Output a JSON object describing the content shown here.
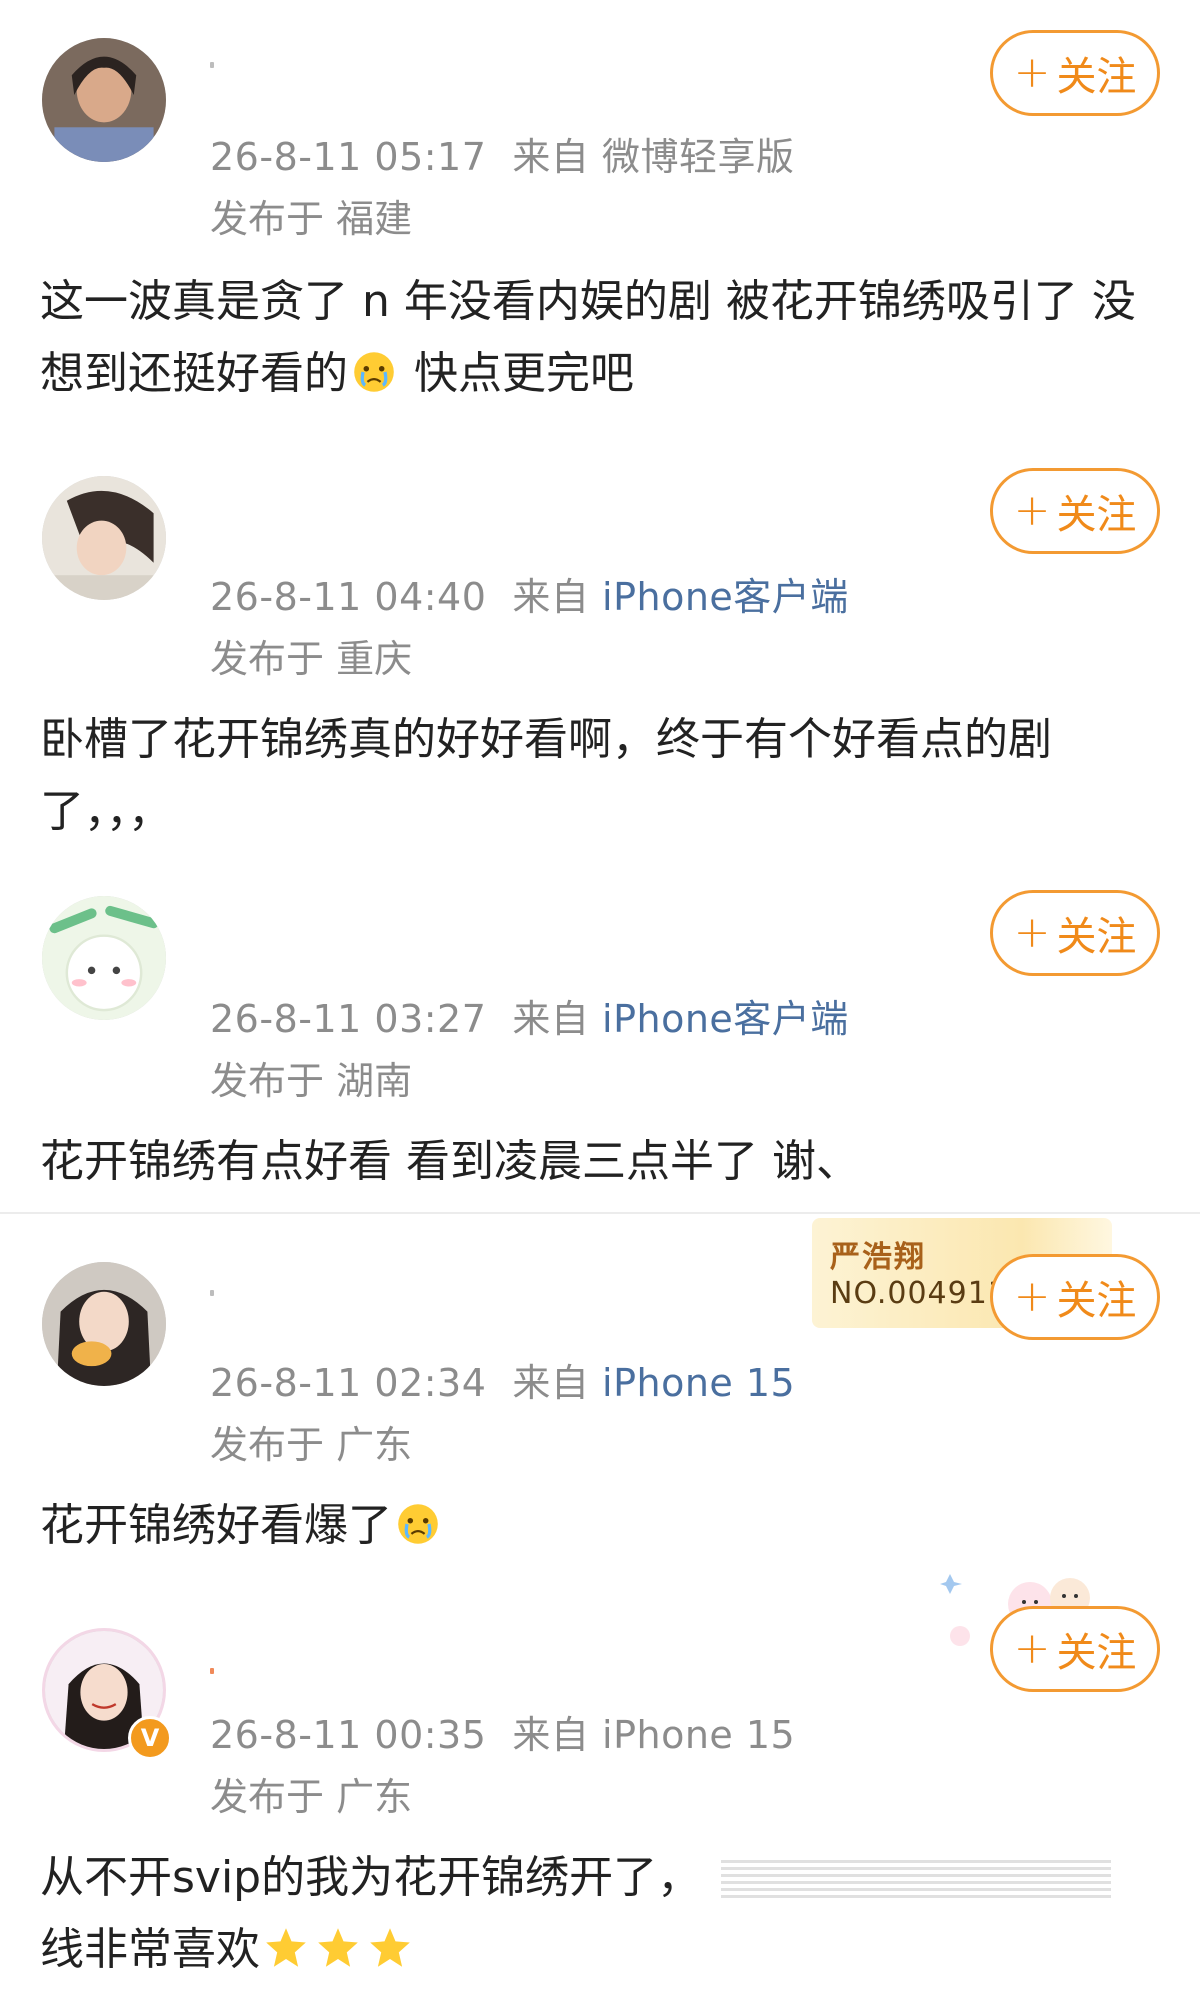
{
  "follow_label": "关注",
  "follow_plus": "+",
  "from_prefix": "来自",
  "location_prefix": "发布于",
  "comments": [
    {
      "time": "26-8-11 05:17",
      "source": "微博轻享版",
      "location": "福建",
      "text_a": "这一波真是贪了 n 年没看内娱的剧 被花开锦绣吸引了 没想到还挺好看的",
      "text_b": " 快点更完吧"
    },
    {
      "time": "26-8-11 04:40",
      "source": "iPhone客户端",
      "location": "重庆",
      "text": "卧槽了花开锦绣真的好好看啊，终于有个好看点的剧了，，，"
    },
    {
      "time": "26-8-11 03:27",
      "source": "iPhone客户端",
      "location": "湖南",
      "text": "花开锦绣有点好看 看到凌晨三点半了 谢、"
    },
    {
      "time": "26-8-11 02:34",
      "source": "iPhone 15",
      "location": "广东",
      "text": "花开锦绣好看爆了",
      "badge_name": "严浩翔",
      "badge_no": "NO.004911"
    },
    {
      "time": "26-8-11 00:35",
      "source": "iPhone 15",
      "location": "广东",
      "text_a": "从不开svip的我为花开锦绣开了，",
      "text_b": "线非常喜欢",
      "vip_mark": "V"
    }
  ],
  "colors": {
    "follow_orange": "#f39a32",
    "meta_gray": "#8c8c8c",
    "device_blue": "#4a6f9f"
  }
}
